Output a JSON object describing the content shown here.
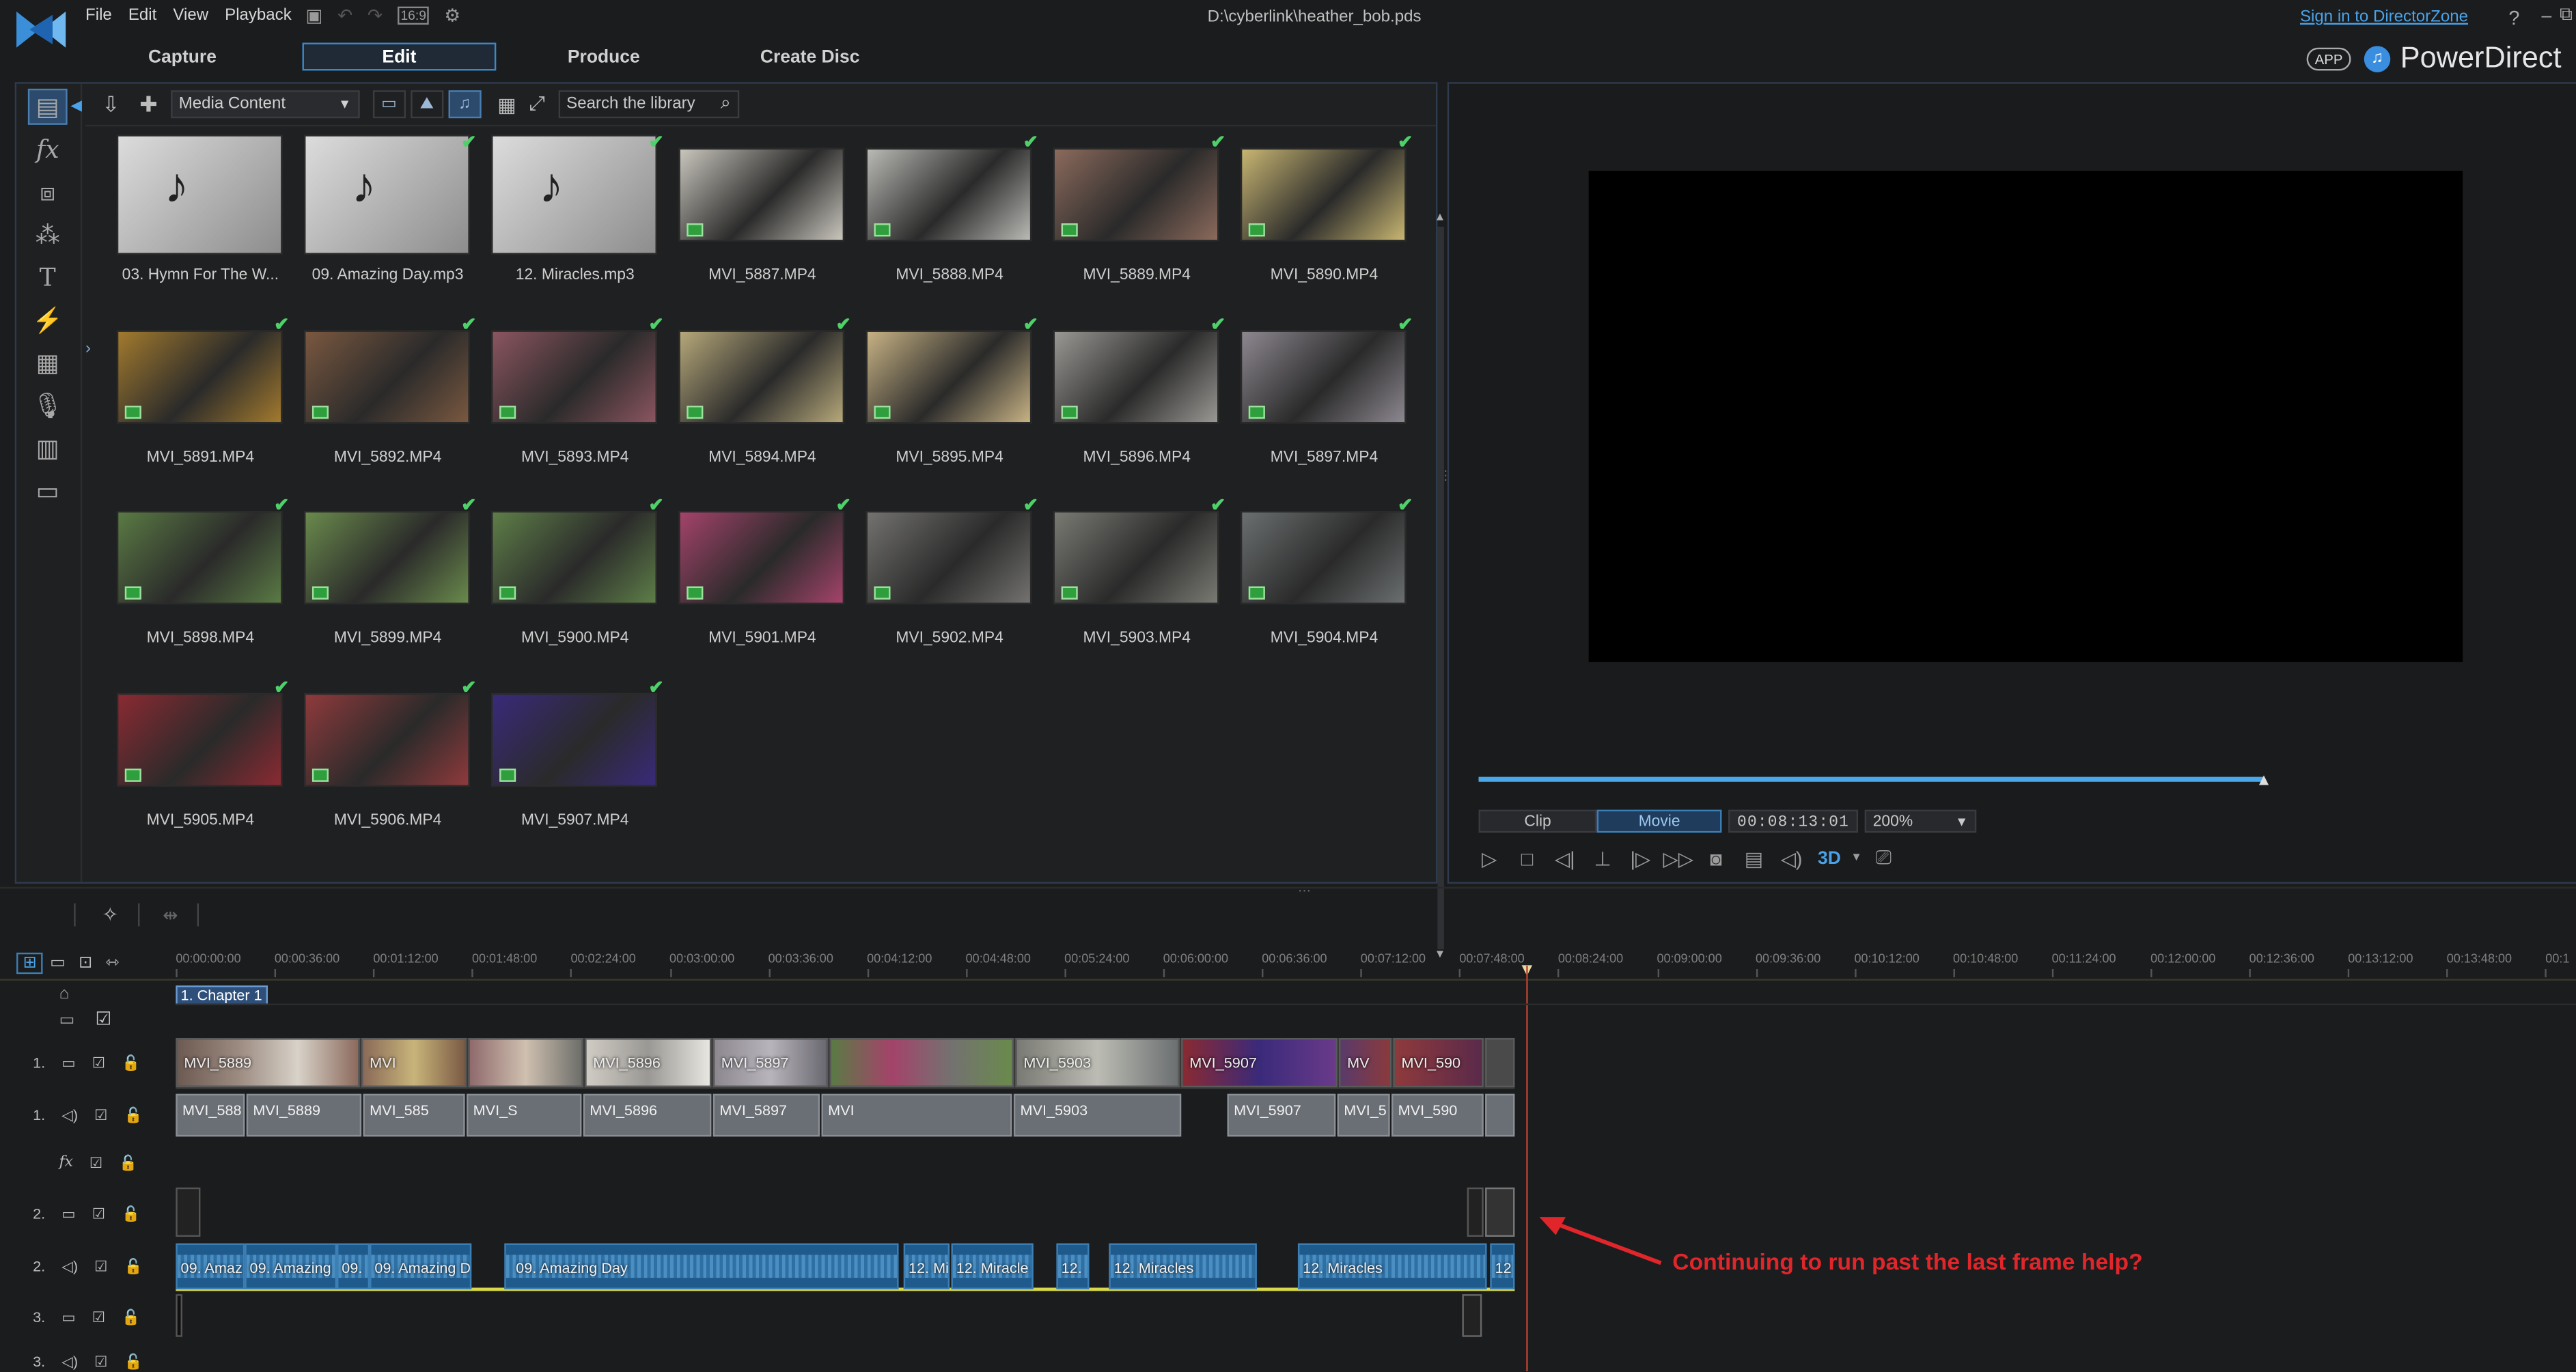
{
  "menu": {
    "file": "File",
    "edit": "Edit",
    "view": "View",
    "playback": "Playback",
    "aspect": "16:9"
  },
  "window": {
    "title": "D:\\cyberlink\\heather_bob.pds",
    "signin": "Sign in to DirectorZone",
    "help": "?",
    "app_badge": "APP",
    "product": "PowerDirect"
  },
  "modes": {
    "capture": "Capture",
    "edit": "Edit",
    "produce": "Produce",
    "create_disc": "Create Disc"
  },
  "library": {
    "filter": "Media Content",
    "search_placeholder": "Search the library",
    "items": [
      {
        "name": "03. Hymn For The W...",
        "type": "audio",
        "used": false,
        "color": "#9a9a9a"
      },
      {
        "name": "09. Amazing Day.mp3",
        "type": "audio",
        "used": true,
        "color": "#9a9a9a"
      },
      {
        "name": "12. Miracles.mp3",
        "type": "audio",
        "used": true,
        "color": "#9a9a9a"
      },
      {
        "name": "MVI_5887.MP4",
        "type": "video",
        "used": false,
        "color": "#c9c6bd"
      },
      {
        "name": "MVI_5888.MP4",
        "type": "video",
        "used": true,
        "color": "#b9bab5"
      },
      {
        "name": "MVI_5889.MP4",
        "type": "video",
        "used": true,
        "color": "#8b6a5c"
      },
      {
        "name": "MVI_5890.MP4",
        "type": "video",
        "used": true,
        "color": "#c8b672"
      },
      {
        "name": "MVI_5891.MP4",
        "type": "video",
        "used": true,
        "color": "#a27a2e"
      },
      {
        "name": "MVI_5892.MP4",
        "type": "video",
        "used": true,
        "color": "#7a5840"
      },
      {
        "name": "MVI_5893.MP4",
        "type": "video",
        "used": true,
        "color": "#8b5560"
      },
      {
        "name": "MVI_5894.MP4",
        "type": "video",
        "used": true,
        "color": "#b6a87a"
      },
      {
        "name": "MVI_5895.MP4",
        "type": "video",
        "used": true,
        "color": "#c7b284"
      },
      {
        "name": "MVI_5896.MP4",
        "type": "video",
        "used": true,
        "color": "#9a9894"
      },
      {
        "name": "MVI_5897.MP4",
        "type": "video",
        "used": true,
        "color": "#8d8890"
      },
      {
        "name": "MVI_5898.MP4",
        "type": "video",
        "used": true,
        "color": "#5a7a44"
      },
      {
        "name": "MVI_5899.MP4",
        "type": "video",
        "used": true,
        "color": "#6a8a4c"
      },
      {
        "name": "MVI_5900.MP4",
        "type": "video",
        "used": true,
        "color": "#5e7e48"
      },
      {
        "name": "MVI_5901.MP4",
        "type": "video",
        "used": true,
        "color": "#a4436a"
      },
      {
        "name": "MVI_5902.MP4",
        "type": "video",
        "used": true,
        "color": "#737270"
      },
      {
        "name": "MVI_5903.MP4",
        "type": "video",
        "used": true,
        "color": "#7a7a74"
      },
      {
        "name": "MVI_5904.MP4",
        "type": "video",
        "used": true,
        "color": "#6b6f70"
      },
      {
        "name": "MVI_5905.MP4",
        "type": "video",
        "used": true,
        "color": "#8a2a32"
      },
      {
        "name": "MVI_5906.MP4",
        "type": "video",
        "used": true,
        "color": "#8f3a3c"
      },
      {
        "name": "MVI_5907.MP4",
        "type": "video",
        "used": true,
        "color": "#3a2a7a"
      }
    ]
  },
  "preview": {
    "clip_label": "Clip",
    "movie_label": "Movie",
    "timecode": "00:08:13:01",
    "zoom": "200%",
    "mode_3d": "3D",
    "position": 0.74
  },
  "timeline": {
    "ruler": [
      "00:00:00:00",
      "00:00:36:00",
      "00:01:12:00",
      "00:01:48:00",
      "00:02:24:00",
      "00:03:00:00",
      "00:03:36:00",
      "00:04:12:00",
      "00:04:48:00",
      "00:05:24:00",
      "00:06:00:00",
      "00:06:36:00",
      "00:07:12:00",
      "00:07:48:00",
      "00:08:24:00",
      "00:09:00:00",
      "00:09:36:00",
      "00:10:12:00",
      "00:10:48:00",
      "00:11:24:00",
      "00:12:00:00",
      "00:12:36:00",
      "00:13:12:00",
      "00:13:48:00",
      "00:1"
    ],
    "chapter": "1. Chapter 1",
    "track_labels": {
      "t1": "1.",
      "t2": "2.",
      "t3": "3."
    },
    "video_clips": [
      "MVI_5889",
      "MVI",
      "MVI_5896",
      "MVI_5897",
      "MVI_5903",
      "MVI_5907",
      "MV",
      "MVI_590"
    ],
    "audio1_clips": [
      "MVI_588",
      "MVI_5889",
      "MVI_585",
      "MVI_S",
      "MVI_5896",
      "MVI_5897",
      "MVI",
      "MVI_5903",
      "MVI_5907",
      "MVI_5",
      "MVI_590"
    ],
    "music_clips": [
      "09. Amaz",
      "09. Amazing",
      "09.",
      "09. Amazing D",
      "09. Amazing Day",
      "12. Mi",
      "12. Miracle",
      "12.",
      "12. Miracles",
      "12. Miracles",
      "12"
    ]
  },
  "annotation": "Continuing to run past the last frame help?"
}
